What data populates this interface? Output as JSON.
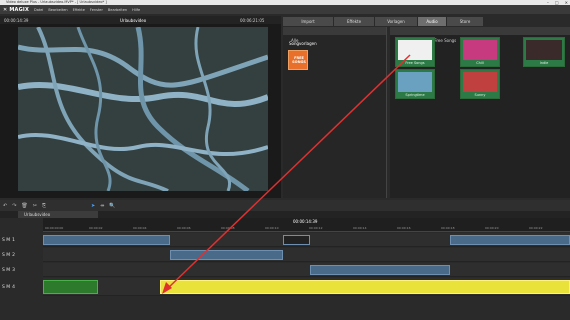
{
  "window": {
    "title": "Video deluxe Plus - Urlaubsvideo.MVP* - [ Urlaubsvideo* ]"
  },
  "menu": {
    "logo": "✕ MAGIX",
    "items": [
      "Datei",
      "Bearbeiten",
      "Effekte",
      "Fenster",
      "Bearbeiten",
      "Hilfe"
    ]
  },
  "preview": {
    "timecode_left": "00:00:14:39",
    "title": "Urlaubsvideo",
    "timecode_right": "00:06:21:05"
  },
  "media_pool": {
    "tabs": [
      "Import",
      "Effekte",
      "Vorlagen",
      "Audio",
      "Store"
    ],
    "active_tab": "Audio",
    "breadcrumb_left": "Alle",
    "section": "Songvorlagen",
    "free_badge": "FREE SONGS",
    "breadcrumb_right": "Songkollektionen - Free Songs",
    "thumbs": [
      {
        "label": "Free Songs"
      },
      {
        "label": "Chill"
      },
      {
        "label": "Indie"
      },
      {
        "label": "Springtime"
      },
      {
        "label": "Sunny"
      }
    ]
  },
  "timeline": {
    "tab": "Urlaubsvideo",
    "ruler_marks": [
      "00:00:00:00",
      "00:00:02",
      "00:00:04",
      "00:00:06",
      "00:00:08",
      "00:00:10",
      "00:00:12",
      "00:00:14",
      "00:00:16",
      "00:00:18",
      "00:00:20",
      "00:00:22"
    ],
    "current": "00:00:14:39"
  },
  "tracks": [
    {
      "label": "S M",
      "num": "1"
    },
    {
      "label": "S M",
      "num": "2"
    },
    {
      "label": "S M",
      "num": "3"
    },
    {
      "label": "S M",
      "num": "4"
    }
  ],
  "colors": {
    "audio": "#e8e23a",
    "arrow": "#e03030",
    "tab_active": "#6e6e6e"
  }
}
